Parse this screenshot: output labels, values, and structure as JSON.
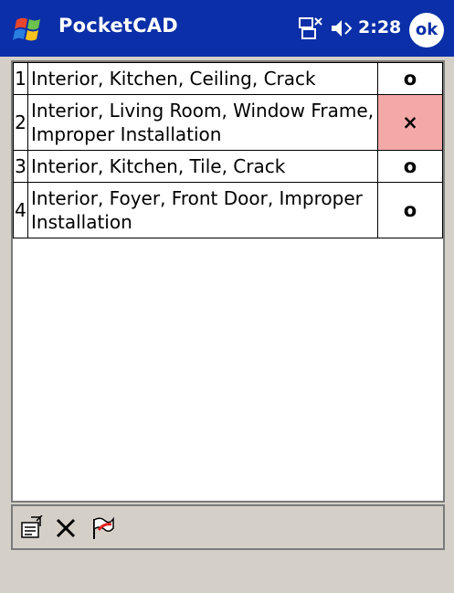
{
  "titlebar": {
    "app_title": "PocketCAD",
    "clock": "2:28",
    "ok_label": "ok",
    "icons": [
      "windows-start-icon",
      "connectivity-icon",
      "volume-icon"
    ]
  },
  "issues": {
    "rows": [
      {
        "number": "1",
        "description": "Interior, Kitchen, Ceiling, Crack",
        "status": "o"
      },
      {
        "number": "2",
        "description": "Interior, Living Room, Window Frame, Improper Installation",
        "status": "×"
      },
      {
        "number": "3",
        "description": "Interior, Kitchen, Tile, Crack",
        "status": "o"
      },
      {
        "number": "4",
        "description": "Interior, Foyer, Front Door, Improper Installation",
        "status": "o"
      }
    ]
  },
  "toolbar": {
    "icons": [
      "properties-icon",
      "delete-icon",
      "flag-icon"
    ]
  },
  "colors": {
    "titlebar_bg": "#0a2fa8",
    "failed_cell_bg": "#f4a8a8",
    "chrome_bg": "#d4d0c8"
  }
}
